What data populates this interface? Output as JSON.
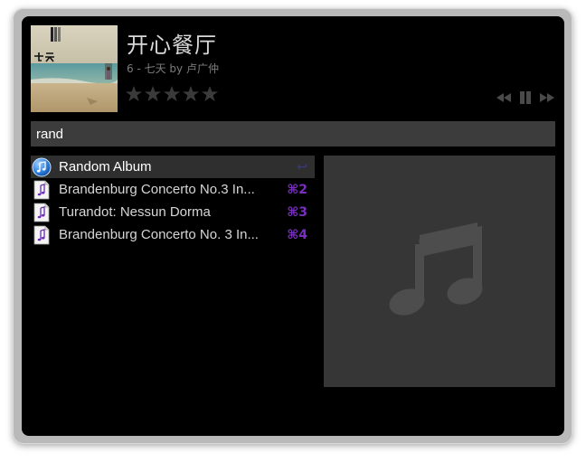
{
  "now_playing": {
    "title": "开心餐厅",
    "subtitle": "6 - 七天 by 卢广仲",
    "rating_stars": 0,
    "rating_max": 5,
    "cover_text": "七天"
  },
  "controls": {
    "previous_icon": "rewind-icon",
    "play_pause_icon": "pause-icon",
    "next_icon": "fast-forward-icon"
  },
  "search": {
    "value": "rand"
  },
  "results": [
    {
      "label": "Random Album",
      "shortcut": "↩",
      "icon": "itunes-icon",
      "selected": true
    },
    {
      "label": "Brandenburg Concerto No.3 In...",
      "shortcut": "⌘2",
      "icon": "music-file-icon",
      "selected": false
    },
    {
      "label": "Turandot: Nessun Dorma",
      "shortcut": "⌘3",
      "icon": "music-file-icon",
      "selected": false
    },
    {
      "label": "Brandenburg Concerto No. 3 In...",
      "shortcut": "⌘4",
      "icon": "music-file-icon",
      "selected": false
    }
  ],
  "artwork_placeholder": {
    "icon": "music-note-icon"
  },
  "colors": {
    "panel_bg": "#000000",
    "search_bg": "#3c3c3c",
    "selected_row_bg": "#2f2f2f",
    "shortcut": "#7a2fc0",
    "artwork_bg": "#363636",
    "star": "#3a3a3a"
  }
}
